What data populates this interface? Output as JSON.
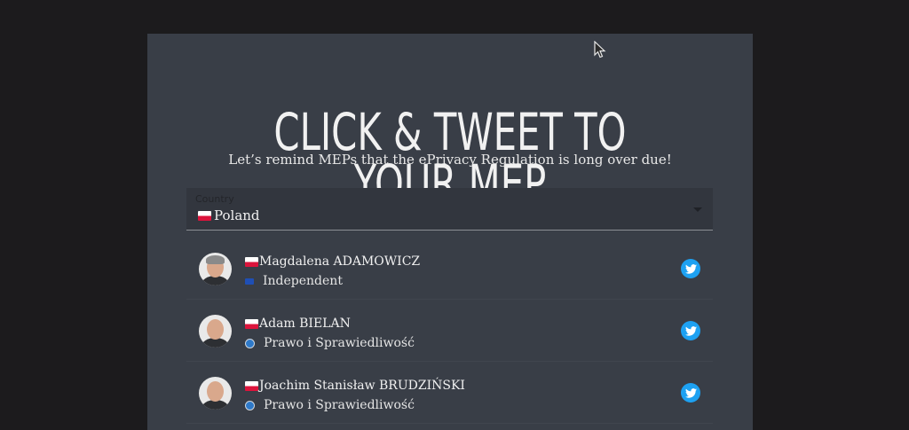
{
  "page": {
    "title": "CLICK & TWEET TO YOUR MEP",
    "subtitle": "Let’s remind MEPs that the ePrivacy Regulation is long over due!"
  },
  "country_select": {
    "label": "Country",
    "value": "Poland",
    "flag_icon": "poland-flag-icon"
  },
  "meps": [
    {
      "name": "Magdalena ADAMOWICZ",
      "party": "Independent",
      "party_icon": "eu-flag-icon",
      "tweet_icon": "twitter-icon"
    },
    {
      "name": "Adam BIELAN",
      "party": "Prawo i Sprawiedliwość",
      "party_icon": "party-logo-icon",
      "tweet_icon": "twitter-icon"
    },
    {
      "name": "Joachim Stanisław BRUDZIŃSKI",
      "party": "Prawo i Sprawiedliwość",
      "party_icon": "party-logo-icon",
      "tweet_icon": "twitter-icon"
    }
  ],
  "colors": {
    "background": "#1c1b1d",
    "panel": "#393e47",
    "twitter": "#1da1f2"
  }
}
